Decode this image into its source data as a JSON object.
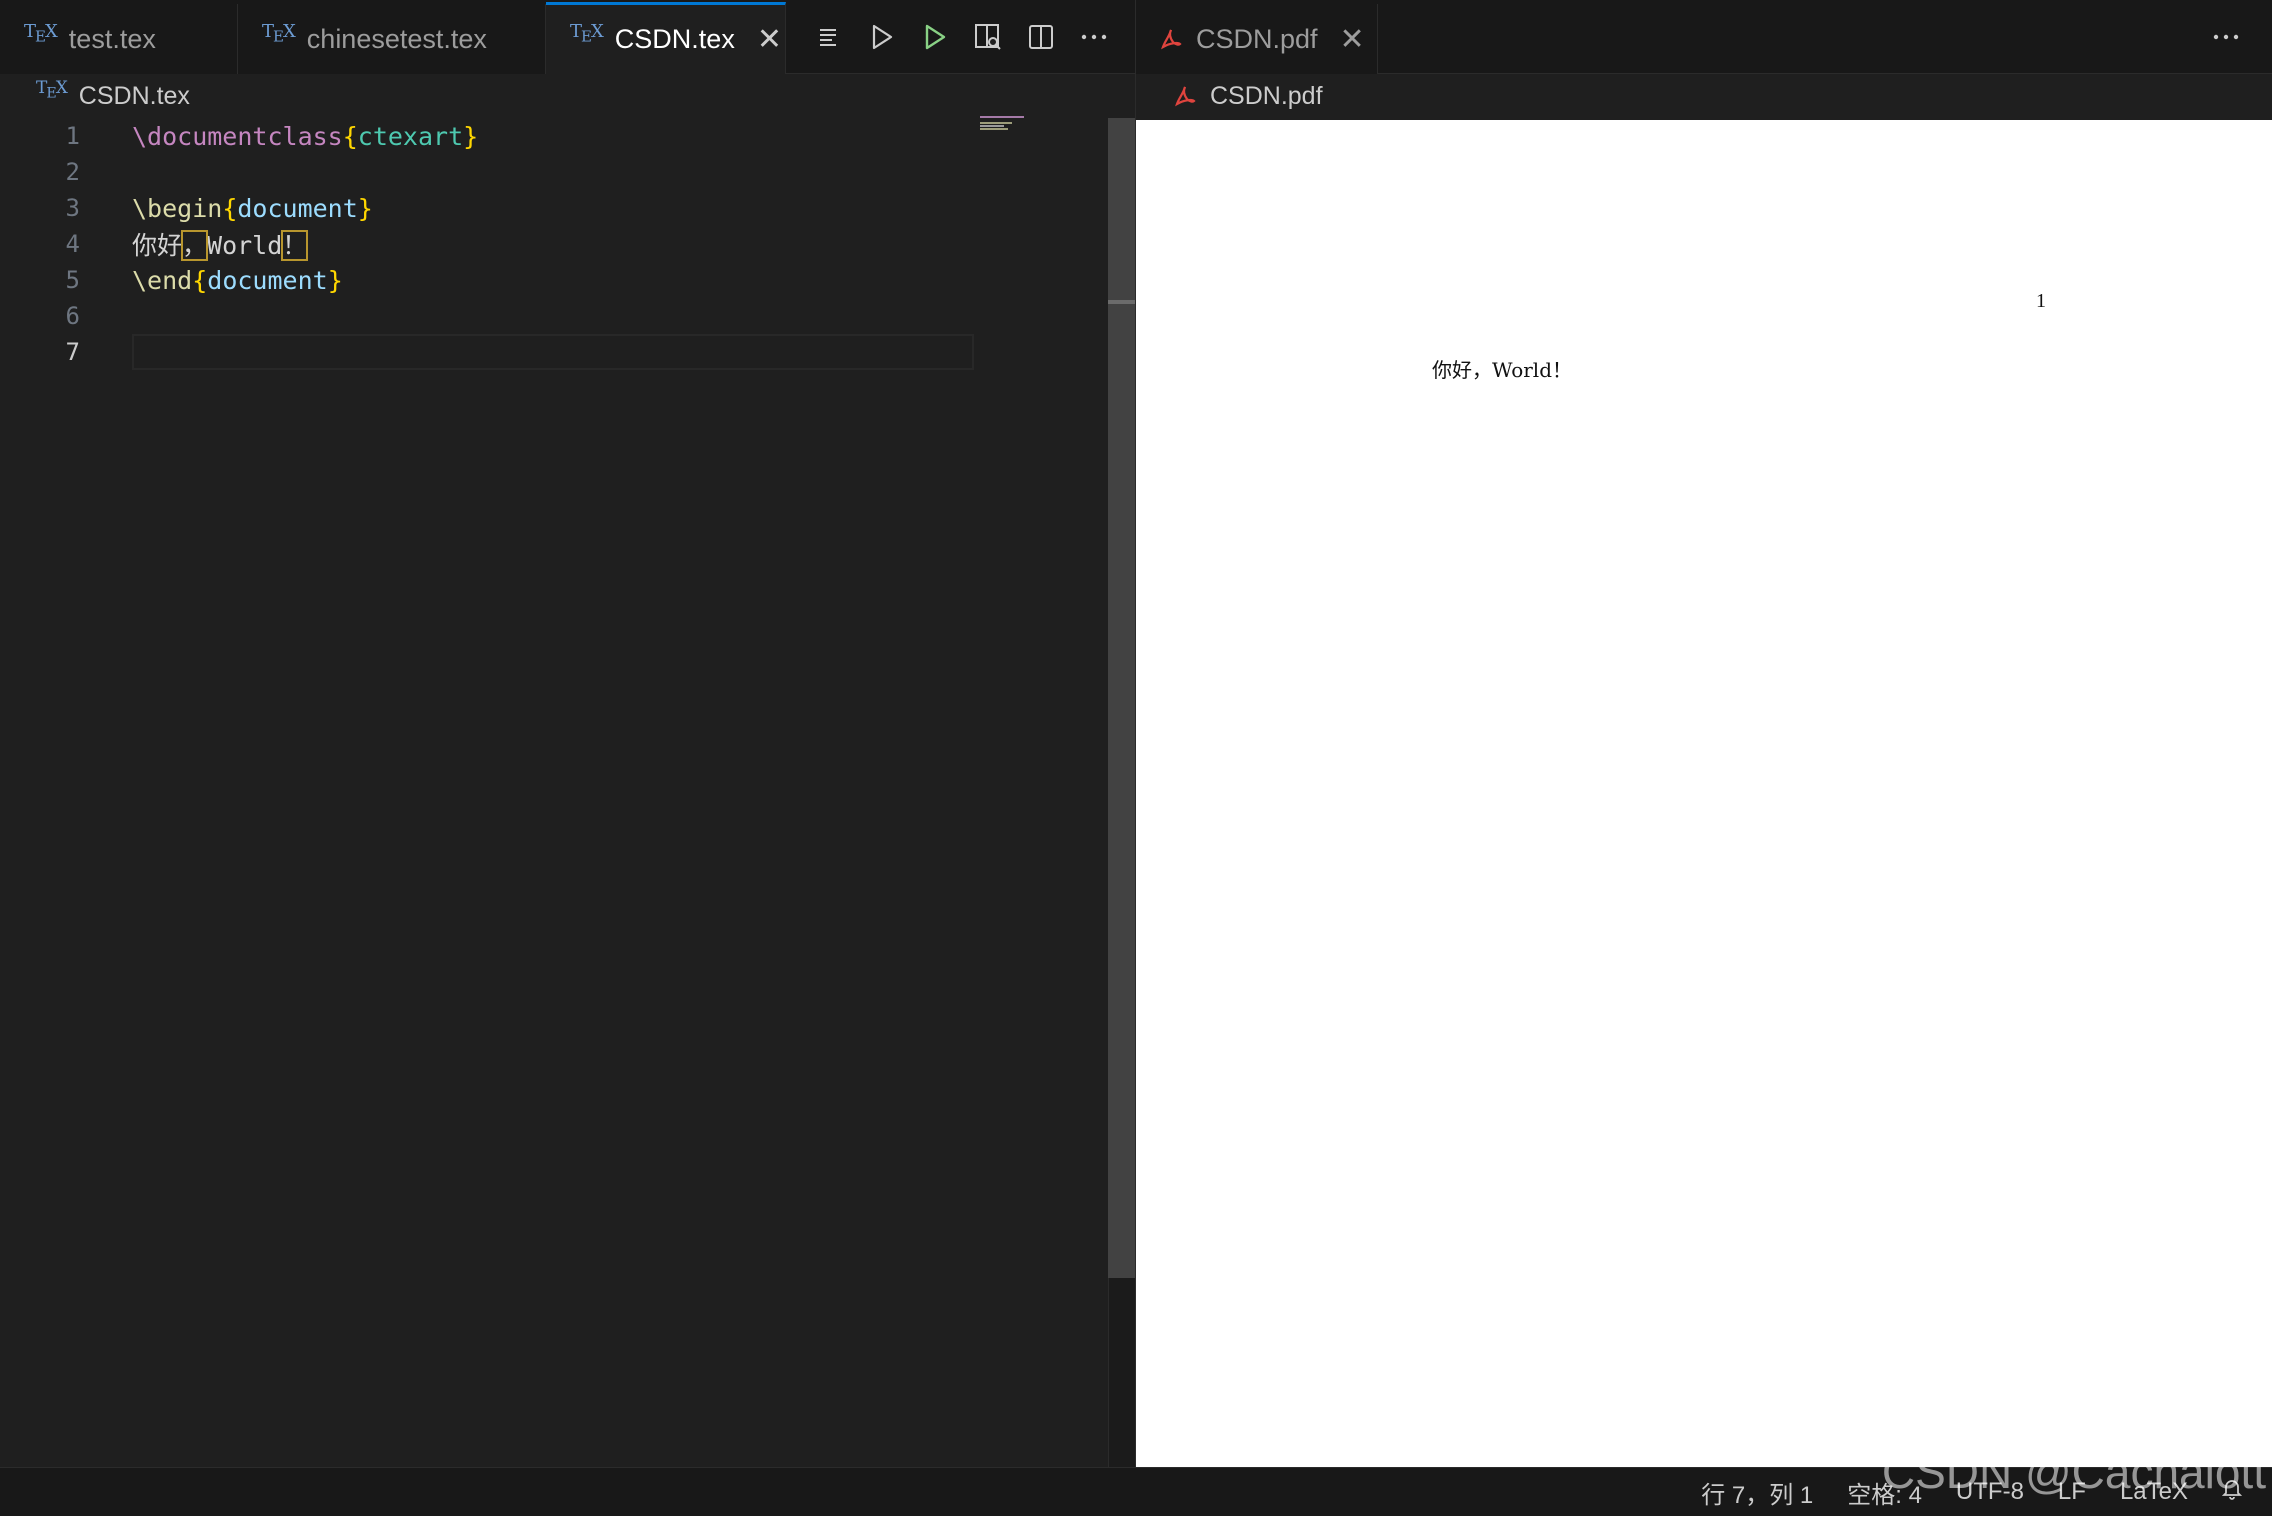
{
  "left_group": {
    "tabs": [
      {
        "label": "test.tex",
        "icon": "tex-icon"
      },
      {
        "label": "chinesetest.tex",
        "icon": "tex-icon"
      },
      {
        "label": "CSDN.tex",
        "icon": "tex-icon",
        "active": true
      }
    ],
    "breadcrumb": "CSDN.tex",
    "actions": [
      "outline-icon",
      "run-icon",
      "run-debug-icon",
      "preview-icon",
      "split-editor-icon",
      "more-actions-icon"
    ]
  },
  "code_lines": [
    {
      "n": "1",
      "text": "\\documentclass{ctexart}"
    },
    {
      "n": "2",
      "text": ""
    },
    {
      "n": "3",
      "text": "\\begin{document}"
    },
    {
      "n": "4",
      "text": "你好，World！"
    },
    {
      "n": "5",
      "text": "\\end{document}"
    },
    {
      "n": "6",
      "text": ""
    },
    {
      "n": "7",
      "text": ""
    }
  ],
  "code_tokens": {
    "l1_cmd": "\\documentclass",
    "l1_open": "{",
    "l1_arg": "ctexart",
    "l1_close": "}",
    "l3_cmd": "\\begin",
    "l3_open": "{",
    "l3_arg": "document",
    "l3_close": "}",
    "l4_a": "你好",
    "l4_b": "，",
    "l4_c": "World",
    "l4_d": "！",
    "l5_cmd": "\\end",
    "l5_open": "{",
    "l5_arg": "document",
    "l5_close": "}"
  },
  "right_group": {
    "tab_label": "CSDN.pdf",
    "breadcrumb": "CSDN.pdf",
    "pdf": {
      "page_number": "1",
      "body_text": "你好，World！"
    }
  },
  "status_bar": {
    "cursor": "行 7，列 1",
    "spaces": "空格: 4",
    "encoding": "UTF-8",
    "eol": "LF",
    "language": "LaTeX"
  },
  "watermark": "CSDN @Cachalott",
  "colors": {
    "accent": "#0078d4",
    "pdf_icon": "#e0443e",
    "run_green": "#89d185"
  }
}
